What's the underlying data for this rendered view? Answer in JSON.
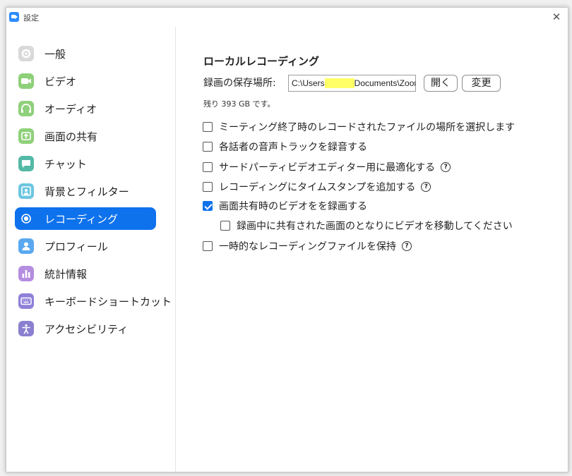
{
  "window": {
    "title": "設定",
    "close_glyph": "✕"
  },
  "sidebar": {
    "items": [
      {
        "label": "一般",
        "icon": "gear-icon",
        "color": "#d9d9d9",
        "active": false
      },
      {
        "label": "ビデオ",
        "icon": "video-camera-icon",
        "color": "#8fd07a",
        "active": false
      },
      {
        "label": "オーディオ",
        "icon": "headphones-icon",
        "color": "#8fd07a",
        "active": false
      },
      {
        "label": "画面の共有",
        "icon": "share-screen-icon",
        "color": "#8fd07a",
        "active": false
      },
      {
        "label": "チャット",
        "icon": "chat-bubble-icon",
        "color": "#54b9a6",
        "active": false
      },
      {
        "label": "背景とフィルター",
        "icon": "background-person-icon",
        "color": "#6cc6e0",
        "active": false
      },
      {
        "label": "レコーディング",
        "icon": "record-icon",
        "color": "#0e72ed",
        "active": true
      },
      {
        "label": "プロフィール",
        "icon": "profile-icon",
        "color": "#5aa9f0",
        "active": false
      },
      {
        "label": "統計情報",
        "icon": "bar-chart-icon",
        "color": "#b58ee0",
        "active": false
      },
      {
        "label": "キーボードショートカット",
        "icon": "keyboard-icon",
        "color": "#8f80d8",
        "active": false
      },
      {
        "label": "アクセシビリティ",
        "icon": "accessibility-icon",
        "color": "#8a7fd0",
        "active": false
      }
    ]
  },
  "recording": {
    "section_title": "ローカルレコーディング",
    "path_label": "録画の保存場所:",
    "path_prefix": "C:\\Users",
    "path_redacted": "xxxxxxx",
    "path_suffix": "Documents\\Zoom",
    "open_button": "開く",
    "change_button": "変更",
    "free_space": "残り 393 GB です。",
    "options": [
      {
        "label": "ミーティング終了時のレコードされたファイルの場所を選択します",
        "checked": false,
        "help": false
      },
      {
        "label": "各話者の音声トラックを録音する",
        "checked": false,
        "help": false
      },
      {
        "label": "サードパーティビデオエディター用に最適化する",
        "checked": false,
        "help": true
      },
      {
        "label": "レコーディングにタイムスタンプを追加する",
        "checked": false,
        "help": true
      },
      {
        "label": "画面共有時のビデオをを録画する",
        "checked": true,
        "help": false
      },
      {
        "label": "録画中に共有された画面のとなりにビデオを移動してください",
        "checked": false,
        "help": false
      },
      {
        "label": "一時的なレコーディングファイルを保持",
        "checked": false,
        "help": true
      }
    ],
    "help_glyph": "?"
  }
}
